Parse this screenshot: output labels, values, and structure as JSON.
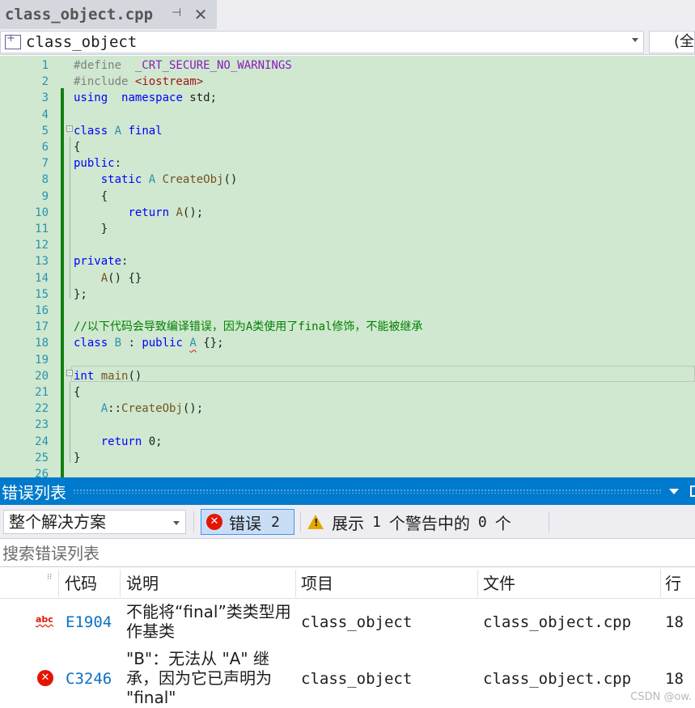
{
  "tab": {
    "title": "class_object.cpp"
  },
  "navbar": {
    "scope": "class_object",
    "member_scope": "(全"
  },
  "editor": {
    "lines": [
      {
        "n": "1",
        "tokens": [
          [
            "pp",
            "#define  "
          ],
          [
            "mac",
            "_CRT_SECURE_NO_WARNINGS"
          ]
        ]
      },
      {
        "n": "2",
        "tokens": [
          [
            "pp",
            "#include "
          ],
          [
            "str",
            "<iostream>"
          ]
        ]
      },
      {
        "n": "3",
        "tokens": [
          [
            "kw",
            "using"
          ],
          [
            "",
            "  "
          ],
          [
            "kw",
            "namespace"
          ],
          [
            "",
            " std;"
          ]
        ]
      },
      {
        "n": "4",
        "tokens": []
      },
      {
        "n": "5",
        "tokens": [
          [
            "kw",
            "class"
          ],
          [
            "",
            " "
          ],
          [
            "ty",
            "A"
          ],
          [
            "",
            " "
          ],
          [
            "kw",
            "final"
          ]
        ]
      },
      {
        "n": "6",
        "tokens": [
          [
            "",
            "{"
          ]
        ]
      },
      {
        "n": "7",
        "tokens": [
          [
            "kw",
            "public"
          ],
          [
            "",
            ":"
          ]
        ]
      },
      {
        "n": "8",
        "tokens": [
          [
            "",
            "    "
          ],
          [
            "kw",
            "static"
          ],
          [
            "",
            " "
          ],
          [
            "ty",
            "A"
          ],
          [
            "",
            " "
          ],
          [
            "fn",
            "CreateObj"
          ],
          [
            "",
            "()"
          ]
        ]
      },
      {
        "n": "9",
        "tokens": [
          [
            "",
            "    {"
          ]
        ]
      },
      {
        "n": "10",
        "tokens": [
          [
            "",
            "        "
          ],
          [
            "kw",
            "return"
          ],
          [
            "",
            " "
          ],
          [
            "fn",
            "A"
          ],
          [
            "",
            "();"
          ]
        ]
      },
      {
        "n": "11",
        "tokens": [
          [
            "",
            "    }"
          ]
        ]
      },
      {
        "n": "12",
        "tokens": []
      },
      {
        "n": "13",
        "tokens": [
          [
            "kw",
            "private"
          ],
          [
            "",
            ":"
          ]
        ]
      },
      {
        "n": "14",
        "tokens": [
          [
            "",
            "    "
          ],
          [
            "fn",
            "A"
          ],
          [
            "",
            "() {}"
          ]
        ]
      },
      {
        "n": "15",
        "tokens": [
          [
            "",
            "};"
          ]
        ]
      },
      {
        "n": "16",
        "tokens": []
      },
      {
        "n": "17",
        "tokens": [
          [
            "cm",
            "//以下代码会导致编译错误，因为A类使用了final修饰，不能被继承"
          ]
        ]
      },
      {
        "n": "18",
        "tokens": [
          [
            "kw",
            "class"
          ],
          [
            "",
            " "
          ],
          [
            "ty",
            "B"
          ],
          [
            "",
            " : "
          ],
          [
            "kw",
            "public"
          ],
          [
            "",
            " "
          ],
          [
            "ty squiggle",
            "A"
          ],
          [
            "",
            " {};"
          ]
        ]
      },
      {
        "n": "19",
        "tokens": []
      },
      {
        "n": "20",
        "tokens": [
          [
            "kw",
            "int"
          ],
          [
            "",
            " "
          ],
          [
            "fn",
            "main"
          ],
          [
            "",
            "()"
          ]
        ]
      },
      {
        "n": "21",
        "tokens": [
          [
            "",
            "{"
          ]
        ]
      },
      {
        "n": "22",
        "tokens": [
          [
            "",
            "    "
          ],
          [
            "ty",
            "A"
          ],
          [
            "",
            "::"
          ],
          [
            "fn",
            "CreateObj"
          ],
          [
            "",
            "();"
          ]
        ]
      },
      {
        "n": "23",
        "tokens": []
      },
      {
        "n": "24",
        "tokens": [
          [
            "",
            "    "
          ],
          [
            "kw",
            "return"
          ],
          [
            "",
            " 0;"
          ]
        ]
      },
      {
        "n": "25",
        "tokens": [
          [
            "",
            "}"
          ]
        ]
      },
      {
        "n": "26",
        "tokens": []
      }
    ]
  },
  "error_list": {
    "title": "错误列表",
    "scope_select": "整个解决方案",
    "errors_label": "错误",
    "errors_count": "2",
    "warnings_prefix": "展示",
    "warnings_shown": "1",
    "warnings_middle": "个警告中的",
    "warnings_total": "0",
    "warnings_suffix": "个",
    "search_placeholder": "搜索错误列表",
    "columns": {
      "code": "代码",
      "description": "说明",
      "project": "项目",
      "file": "文件",
      "line": "行"
    },
    "rows": [
      {
        "icon": "spell-error-icon",
        "code": "E1904",
        "description": "不能将“final”类类型用作基类",
        "project": "class_object",
        "file": "class_object.cpp",
        "line": "18"
      },
      {
        "icon": "error-icon",
        "code": "C3246",
        "description": "\"B\"：无法从 \"A\" 继承，因为它已声明为 \"final\"",
        "project": "class_object",
        "file": "class_object.cpp",
        "line": "18"
      }
    ]
  },
  "watermark": "CSDN @ow.",
  "colors": {
    "accent": "#007acc",
    "editor_bg": "#cfe8cf",
    "error": "#e51400",
    "warning": "#e6a700",
    "link": "#0e70c0"
  }
}
